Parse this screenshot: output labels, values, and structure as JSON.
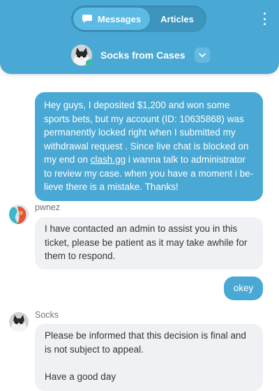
{
  "header": {
    "tabs": [
      {
        "label": "Messages",
        "icon": "chat-bubble-icon",
        "active": true
      },
      {
        "label": "Articles",
        "active": false
      }
    ],
    "menu_icon": "kebab-menu-icon",
    "agent": {
      "name": "Socks from Cases",
      "status": "online",
      "avatar_icon": "cat-avatar-icon",
      "dropdown_icon": "chevron-down-icon"
    }
  },
  "messages": [
    {
      "direction": "outgoing",
      "text_before": "Hey guys, I deposited $1,200 and won some sports bets, but my account (ID: 10635868) was permanently locked right when I submitted my withdrawal request . Since live chat is blocked on my end on ",
      "link": "clash.gg",
      "text_after": " i wanna talk to administrator to review my case. when you have a moment i be-lieve there is a mistake. Thanks!"
    },
    {
      "direction": "incoming",
      "sender": "pwnez",
      "text": "I have contacted an admin to assist you in this ticket, please be patient as it may take awhile for them to respond."
    },
    {
      "direction": "outgoing",
      "text": "okey"
    },
    {
      "direction": "incoming",
      "sender": "Socks",
      "paragraphs": [
        "Please be informed that this decision is final and is not subject to appeal.",
        "Have a good day"
      ]
    }
  ],
  "colors": {
    "accent": "#4aa9d4",
    "incoming_bubble": "#f0f1f4",
    "online": "#2ecc71"
  }
}
